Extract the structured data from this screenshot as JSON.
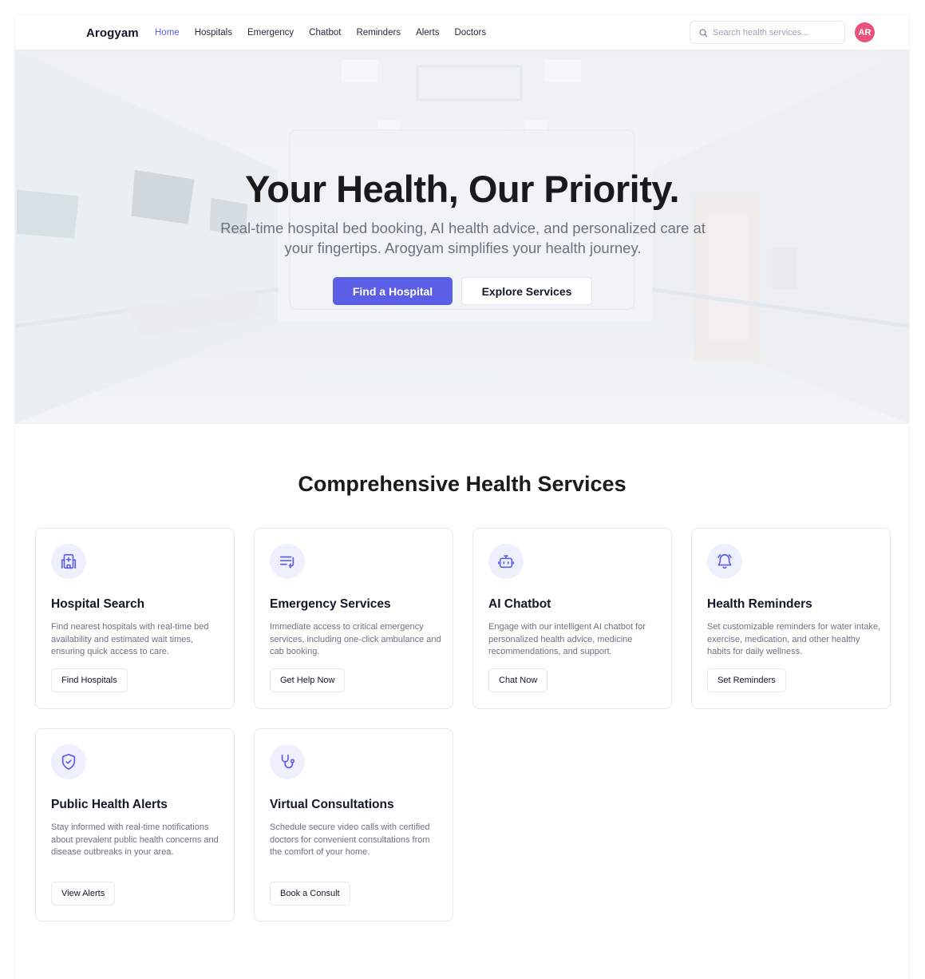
{
  "navbar": {
    "brand": "Arogyam",
    "links": [
      {
        "label": "Home",
        "active": true
      },
      {
        "label": "Hospitals",
        "active": false
      },
      {
        "label": "Emergency",
        "active": false
      },
      {
        "label": "Chatbot",
        "active": false
      },
      {
        "label": "Reminders",
        "active": false
      },
      {
        "label": "Alerts",
        "active": false
      },
      {
        "label": "Doctors",
        "active": false
      }
    ],
    "search": {
      "placeholder": "Search health services...",
      "icon": "search-icon"
    },
    "avatar_initials": "AR",
    "avatar_color": "#e8527b",
    "accent_color": "#5b63e6"
  },
  "hero": {
    "title": "Your Health, Our Priority.",
    "subtitle": "Real-time hospital bed booking, AI health advice, and personalized care at your fingertips. Arogyam simplifies your health journey.",
    "primary_button": "Find a Hospital",
    "secondary_button": "Explore Services",
    "background": "hospital-corridor-image",
    "primary_color": "#5b5fe6"
  },
  "services": {
    "title": "Comprehensive Health Services",
    "cards": [
      {
        "title": "Hospital Search",
        "description": "Find nearest hospitals with real-time bed availability and estimated wait times, ensuring quick access to care.",
        "button": "Find Hospitals",
        "icon": "hospital-icon"
      },
      {
        "title": "Emergency Services",
        "description": "Immediate access to critical emergency services, including one-click ambulance and cab booking.",
        "button": "Get Help Now",
        "icon": "siren-list-icon"
      },
      {
        "title": "AI Chatbot",
        "description": "Engage with our intelligent AI chatbot for personalized health advice, medicine recommendations, and support.",
        "button": "Chat Now",
        "icon": "bot-icon"
      },
      {
        "title": "Health Reminders",
        "description": "Set customizable reminders for water intake, exercise, medication, and other healthy habits for daily wellness.",
        "button": "Set Reminders",
        "icon": "bell-ring-icon"
      },
      {
        "title": "Public Health Alerts",
        "description": "Stay informed with real-time notifications about prevalent public health concerns and disease outbreaks in your area.",
        "button": "View Alerts",
        "icon": "shield-check-icon"
      },
      {
        "title": "Virtual Consultations",
        "description": "Schedule secure video calls with certified doctors for convenient consultations from the comfort of your home.",
        "button": "Book a Consult",
        "icon": "stethoscope-icon"
      }
    ]
  }
}
